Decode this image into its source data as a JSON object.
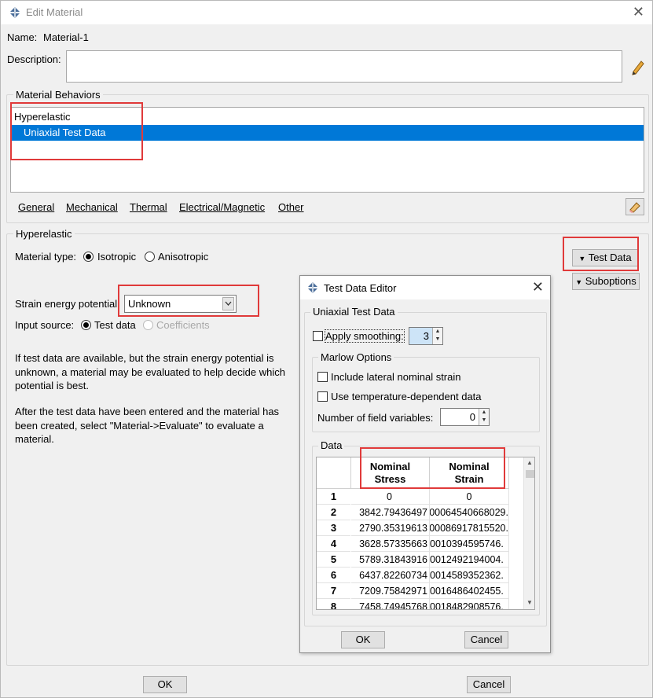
{
  "window": {
    "title": "Edit Material",
    "close_glyph": "✕"
  },
  "name": {
    "label": "Name:",
    "value": "Material-1"
  },
  "description": {
    "label": "Description:",
    "value": ""
  },
  "behaviors": {
    "group_title": "Material Behaviors",
    "items": [
      {
        "label": "Hyperelastic",
        "selected": false
      },
      {
        "label": "Uniaxial Test Data",
        "selected": true
      }
    ],
    "menu": [
      "General",
      "Mechanical",
      "Thermal",
      "Electrical/Magnetic",
      "Other"
    ]
  },
  "hyperelastic": {
    "group_title": "Hyperelastic",
    "material_type_label": "Material type:",
    "material_type_options": [
      "Isotropic",
      "Anisotropic"
    ],
    "material_type_selected": "Isotropic",
    "strain_energy_label": "Strain energy potential:",
    "strain_energy_value": "Unknown",
    "input_source_label": "Input source:",
    "input_source_options": [
      "Test data",
      "Coefficients"
    ],
    "input_source_selected": "Test data",
    "test_data_button": "Test Data",
    "suboptions_button": "Suboptions",
    "info_1": "If test data are available, but the strain energy potential is unknown, a material may be evaluated to help decide which potential is best.",
    "info_2": "After the test data have been entered and the material has been created, select \"Material->Evaluate\" to evaluate a material."
  },
  "editor": {
    "title": "Test Data Editor",
    "group_title": "Uniaxial Test Data",
    "apply_smoothing_label": "Apply smoothing:",
    "apply_smoothing_checked": false,
    "smoothing_value": "3",
    "marlow": {
      "title": "Marlow Options",
      "lateral_label": "Include lateral nominal strain",
      "temperature_label": "Use temperature-dependent data",
      "field_vars_label": "Number of field variables:",
      "field_vars_value": "0"
    },
    "data_title": "Data",
    "columns": [
      "Nominal Stress",
      "Nominal Strain"
    ],
    "column_lines": [
      [
        "Nominal",
        "Stress"
      ],
      [
        "Nominal",
        "Strain"
      ]
    ],
    "rows": [
      [
        "1",
        "0",
        "0"
      ],
      [
        "2",
        "3842.79436497",
        ".00064540668029"
      ],
      [
        "3",
        "2790.35319613",
        ".00086917815520"
      ],
      [
        "4",
        "3628.57335663",
        ".0010394595746"
      ],
      [
        "5",
        "5789.31843916",
        ".0012492194004"
      ],
      [
        "6",
        "6437.82260734",
        ".0014589352362"
      ],
      [
        "7",
        "7209.75842971",
        ".0016486402455"
      ],
      [
        "8",
        "7458.74945768",
        ".0018482908576"
      ]
    ],
    "ok": "OK",
    "cancel": "Cancel"
  },
  "footer": {
    "ok": "OK",
    "cancel": "Cancel"
  },
  "colors": {
    "selection": "#0078d7",
    "highlight_box": "#e03a3a"
  }
}
